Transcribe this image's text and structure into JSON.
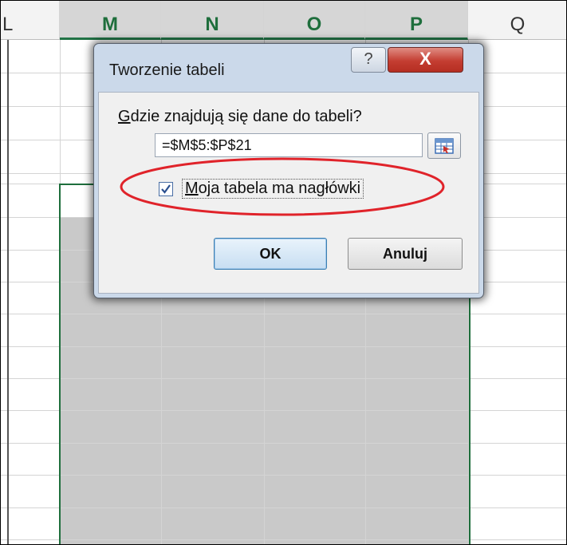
{
  "sheet": {
    "columns": [
      "L",
      "M",
      "N",
      "O",
      "P",
      "Q"
    ],
    "selected_columns": [
      "M",
      "N",
      "O",
      "P"
    ],
    "accent_color": "#217346"
  },
  "dialog": {
    "title": "Tworzenie tabeli",
    "help_label": "?",
    "close_label": "X",
    "prompt_accel": "G",
    "prompt_rest": "dzie znajdują się dane do tabeli?",
    "range_value": "=$M$5:$P$21",
    "range_button_icon": "collapse-dialog-icon",
    "checkbox_checked": true,
    "checkbox_accel": "M",
    "checkbox_rest": "oja tabela ma nagłówki",
    "ok_label": "OK",
    "cancel_label": "Anuluj"
  },
  "annotation": {
    "shape": "ellipse",
    "color": "#e0232a",
    "target": "checkbox"
  }
}
